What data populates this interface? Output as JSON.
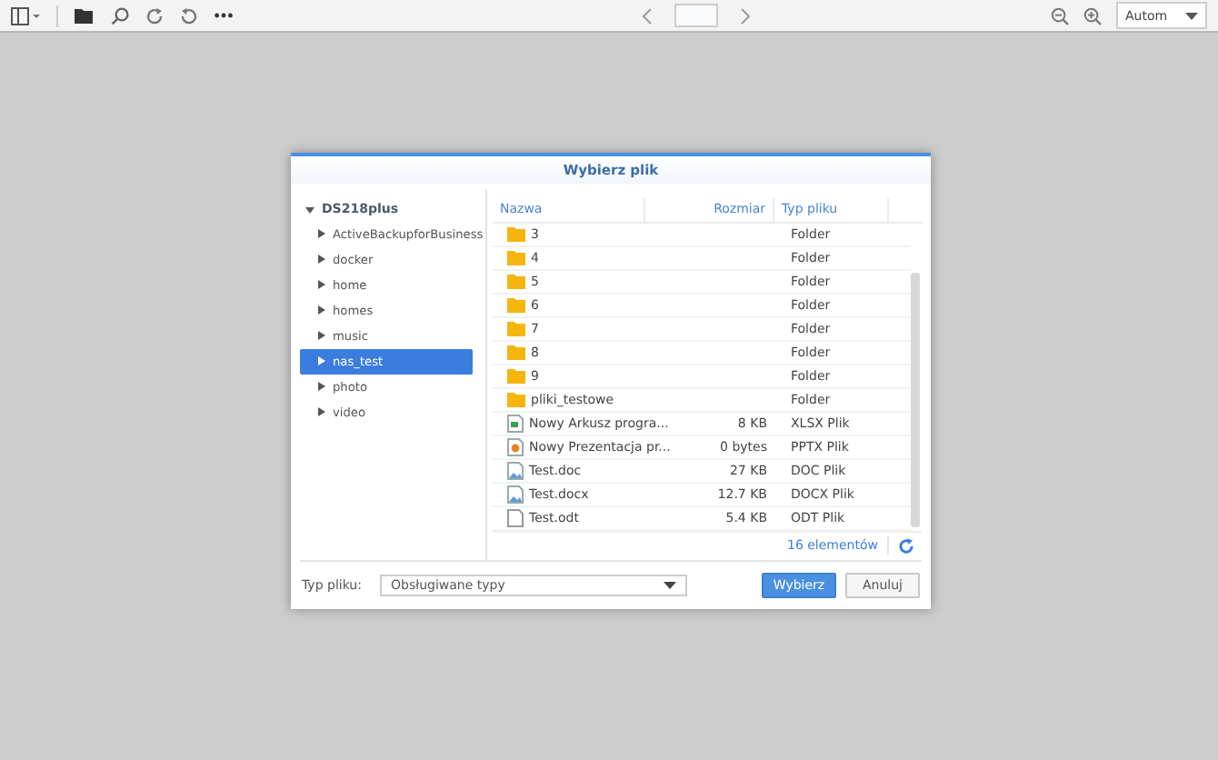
{
  "toolbar": {
    "zoom_select": "Autom"
  },
  "dialog": {
    "title": "Wybierz plik",
    "tree": {
      "label": "DS218plus",
      "expanded": true,
      "children": [
        {
          "label": "ActiveBackupforBusiness",
          "selected": false
        },
        {
          "label": "docker",
          "selected": false
        },
        {
          "label": "home",
          "selected": false
        },
        {
          "label": "homes",
          "selected": false
        },
        {
          "label": "music",
          "selected": false
        },
        {
          "label": "nas_test",
          "selected": true
        },
        {
          "label": "photo",
          "selected": false
        },
        {
          "label": "video",
          "selected": false
        }
      ]
    },
    "columns": [
      "Nazwa",
      "Rozmiar",
      "Typ pliku"
    ],
    "rows": [
      {
        "kind": "folder",
        "name": "3",
        "size": "",
        "type": "Folder"
      },
      {
        "kind": "folder",
        "name": "4",
        "type": "Folder"
      },
      {
        "kind": "folder",
        "name": "5",
        "type": "Folder"
      },
      {
        "kind": "folder",
        "name": "6",
        "type": "Folder"
      },
      {
        "kind": "folder",
        "name": "7",
        "type": "Folder"
      },
      {
        "kind": "folder",
        "name": "8",
        "type": "Folder"
      },
      {
        "kind": "folder",
        "name": "9",
        "type": "Folder"
      },
      {
        "kind": "folder",
        "name": "pliki_testowe",
        "type": "Folder"
      },
      {
        "kind": "sheet",
        "name": "Nowy Arkusz progra...",
        "size": "8 KB",
        "type": "XLSX Plik"
      },
      {
        "kind": "slides",
        "name": "Nowy Prezentacja pr...",
        "size": "0 bytes",
        "type": "PPTX Plik"
      },
      {
        "kind": "doc",
        "name": "Test.doc",
        "size": "27 KB",
        "type": "DOC Plik"
      },
      {
        "kind": "doc",
        "name": "Test.docx",
        "size": "12.7 KB",
        "type": "DOCX Plik"
      },
      {
        "kind": "text",
        "name": "Test.odt",
        "size": "5.4 KB",
        "type": "ODT Plik"
      }
    ],
    "count": "16 elementów",
    "filter_label": "Typ pliku:",
    "filter_value": "Obsługiwane typy",
    "buttons": [
      {
        "label": "Wybierz",
        "primary": true
      },
      {
        "label": "Anuluj",
        "primary": false
      }
    ]
  }
}
